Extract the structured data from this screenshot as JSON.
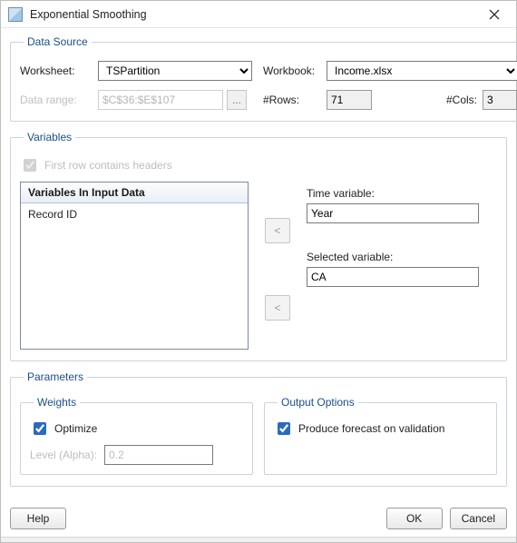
{
  "window": {
    "title": "Exponential Smoothing"
  },
  "dataSource": {
    "legend": "Data Source",
    "worksheet_label": "Worksheet:",
    "worksheet_value": "TSPartition",
    "workbook_label": "Workbook:",
    "workbook_value": "Income.xlsx",
    "data_range_label": "Data range:",
    "data_range_value": "$C$36:$E$107",
    "ellipsis": "...",
    "rows_label": "#Rows:",
    "rows_value": "71",
    "cols_label": "#Cols:",
    "cols_value": "3"
  },
  "variables": {
    "legend": "Variables",
    "first_row_label": "First row contains headers",
    "first_row_checked": true,
    "list_header": "Variables In Input Data",
    "list_items": [
      "Record ID"
    ],
    "move_left_glyph": "<",
    "move_right_glyph": "<",
    "time_label": "Time variable:",
    "time_value": "Year",
    "selected_label": "Selected variable:",
    "selected_value": "CA"
  },
  "parameters": {
    "legend": "Parameters",
    "weights": {
      "legend": "Weights",
      "optimize_label": "Optimize",
      "optimize_checked": true,
      "level_label": "Level (Alpha):",
      "level_value": "0.2"
    },
    "output": {
      "legend": "Output Options",
      "produce_label": "Produce forecast on validation",
      "produce_checked": true
    }
  },
  "buttons": {
    "help": "Help",
    "ok": "OK",
    "cancel": "Cancel"
  }
}
